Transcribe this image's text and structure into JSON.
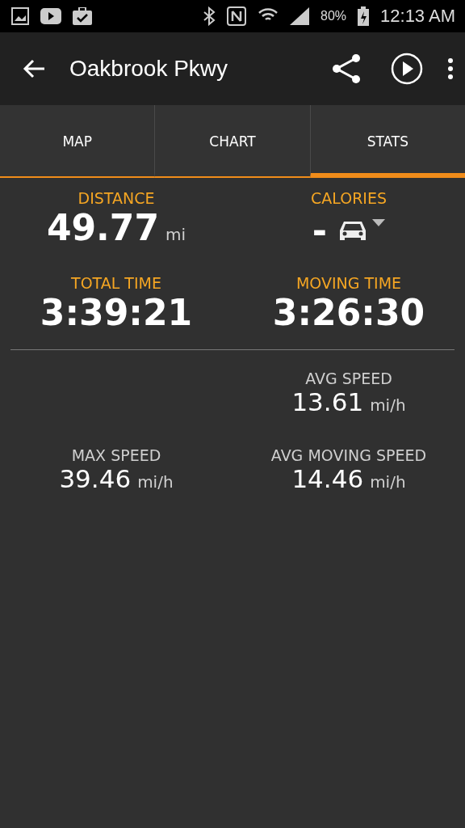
{
  "status_bar": {
    "battery": "80%",
    "time": "12:13 AM"
  },
  "app_bar": {
    "title": "Oakbrook Pkwy"
  },
  "tabs": [
    {
      "label": "MAP",
      "selected": false
    },
    {
      "label": "CHART",
      "selected": false
    },
    {
      "label": "STATS",
      "selected": true
    }
  ],
  "summary": [
    {
      "kind": "value",
      "label": "DISTANCE",
      "value": "49.77",
      "unit": "mi"
    },
    {
      "kind": "activity",
      "label": "CALORIES",
      "value": "-"
    },
    {
      "kind": "value",
      "label": "TOTAL TIME",
      "value": "3:39:21"
    },
    {
      "kind": "value",
      "label": "MOVING TIME",
      "value": "3:26:30"
    }
  ],
  "speed_rows": [
    {
      "right": {
        "label": "AVG SPEED",
        "value": "13.61",
        "unit": "mi/h"
      }
    },
    {
      "left": {
        "label": "MAX SPEED",
        "value": "39.46",
        "unit": "mi/h"
      },
      "right": {
        "label": "AVG MOVING SPEED",
        "value": "14.46",
        "unit": "mi/h"
      }
    }
  ]
}
